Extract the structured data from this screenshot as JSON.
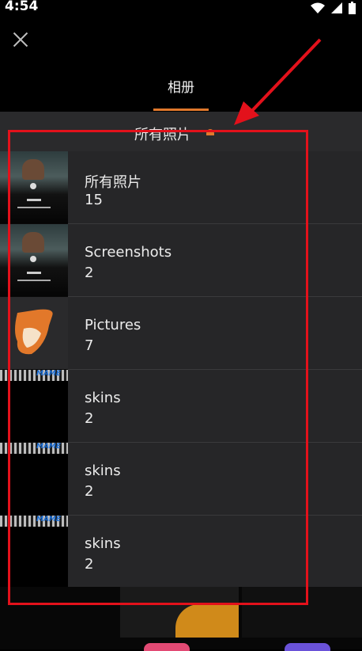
{
  "status": {
    "time": "4:54"
  },
  "header": {
    "tab_label": "相册",
    "accent_color": "#e0782c"
  },
  "dropdown": {
    "selected": "所有照片",
    "albums": [
      {
        "name": "所有照片",
        "count": "15",
        "thumb": "photo"
      },
      {
        "name": "Screenshots",
        "count": "2",
        "thumb": "photo"
      },
      {
        "name": "Pictures",
        "count": "7",
        "thumb": "app-icon"
      },
      {
        "name": "skins",
        "count": "2",
        "thumb": "game"
      },
      {
        "name": "skins",
        "count": "2",
        "thumb": "game"
      },
      {
        "name": "skins",
        "count": "2",
        "thumb": "game"
      }
    ]
  },
  "annotation": {
    "color": "#e3111b"
  }
}
